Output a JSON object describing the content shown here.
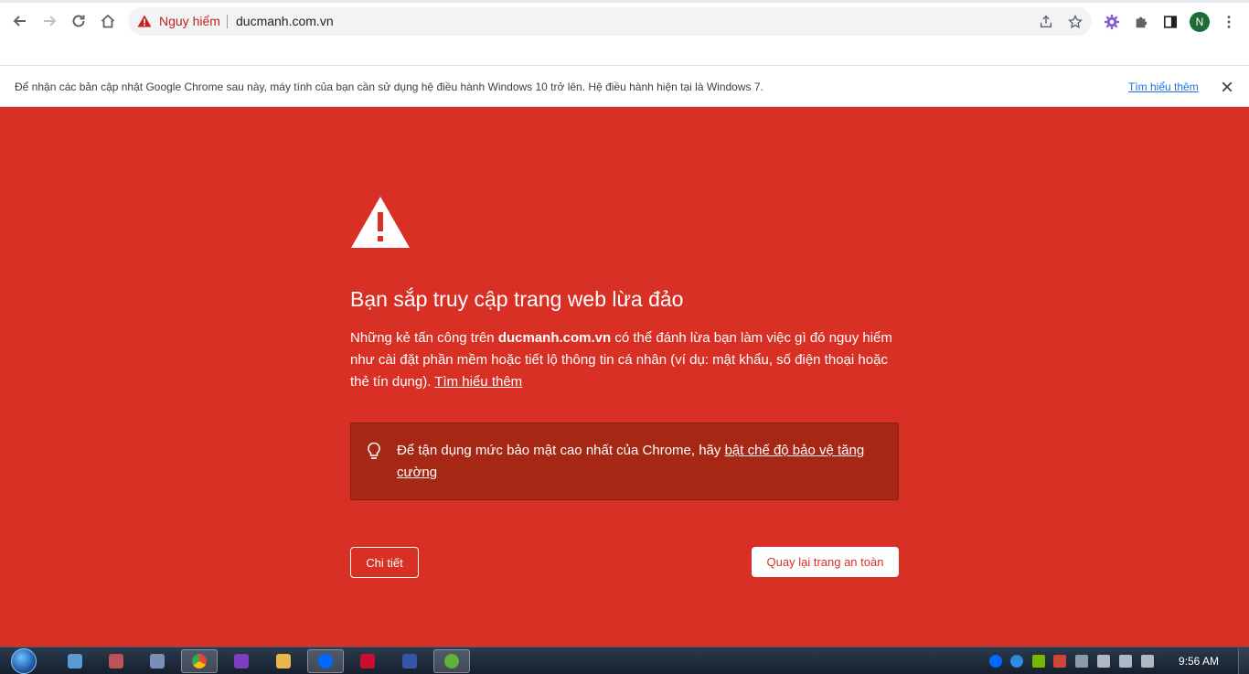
{
  "browser": {
    "security_label": "Nguy hiểm",
    "url": "ducmanh.com.vn",
    "profile_initial": "N"
  },
  "infobar": {
    "message": "Để nhận các bản cập nhật Google Chrome sau này, máy tính của bạn cần sử dụng hệ điều hành Windows 10 trở lên. Hệ điều hành hiện tại là Windows 7.",
    "link": "Tìm hiểu thêm"
  },
  "interstitial": {
    "heading": "Bạn sắp truy cập trang web lừa đảo",
    "desc_prefix": "Những kẻ tấn công trên ",
    "desc_domain": "ducmanh.com.vn",
    "desc_suffix": " có thể đánh lừa bạn làm việc gì đó nguy hiểm như cài đặt phần mềm hoặc tiết lộ thông tin cá nhân (ví dụ: mật khẩu, số điện thoại hoặc thẻ tín dụng). ",
    "learn_more": "Tìm hiểu thêm",
    "tip_prefix": "Để tận dụng mức bảo mật cao nhất của Chrome, hãy ",
    "tip_link": "bật chế độ bảo vệ tăng cường",
    "details_button": "Chi tiết",
    "back_button": "Quay lại trang an toàn"
  },
  "taskbar": {
    "clock": "9:56 AM"
  },
  "colors": {
    "page_bg": "#d93025",
    "tip_bg": "#a52714",
    "danger_text": "#c5221f",
    "link_blue": "#1a73e8"
  },
  "icons": [
    "back-arrow-icon",
    "forward-arrow-icon",
    "reload-icon",
    "home-icon",
    "warning-triangle-icon",
    "share-icon",
    "star-icon",
    "extension-gear-icon",
    "puzzle-icon",
    "side-panel-icon",
    "more-vert-icon",
    "close-icon",
    "lightbulb-icon"
  ]
}
